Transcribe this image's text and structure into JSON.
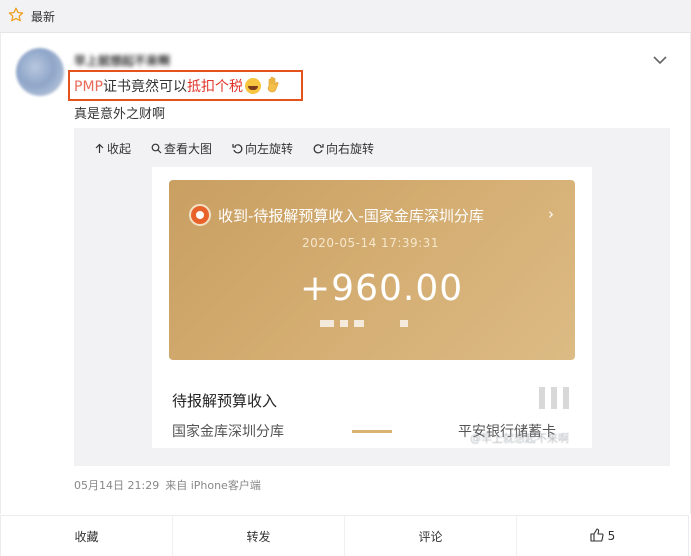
{
  "topbar": {
    "title": "最新",
    "icon": "star-icon"
  },
  "post": {
    "username": "早上就想起不来啊",
    "text_parts": {
      "pmp": "PMP",
      "mid": "证书竟然可以",
      "highlight": "抵扣个税"
    },
    "line2": "真是意外之财啊",
    "image_tools": {
      "collapse": "收起",
      "view_large": "查看大图",
      "rotate_left": "向左旋转",
      "rotate_right": "向右旋转"
    },
    "screenshot": {
      "title": "收到-待报解预算收入-国家金库深圳分库",
      "arrow": "›",
      "timestamp": "2020-05-14 17:39:31",
      "amount": "+960.00",
      "label": "待报解预算收入",
      "from": "国家金库深圳分库",
      "to": "平安银行储蓄卡",
      "watermark": "@早上就想起不来啊"
    },
    "meta": {
      "time": "05月14日 21:29",
      "source": "来自 iPhone客户端"
    }
  },
  "actions": {
    "favorite": "收藏",
    "repost": "转发",
    "comment": "评论",
    "like_count": "5"
  },
  "colors": {
    "accent_red": "#e0352b",
    "highlight_box": "#e5531c",
    "gold": "#d4ad72"
  }
}
